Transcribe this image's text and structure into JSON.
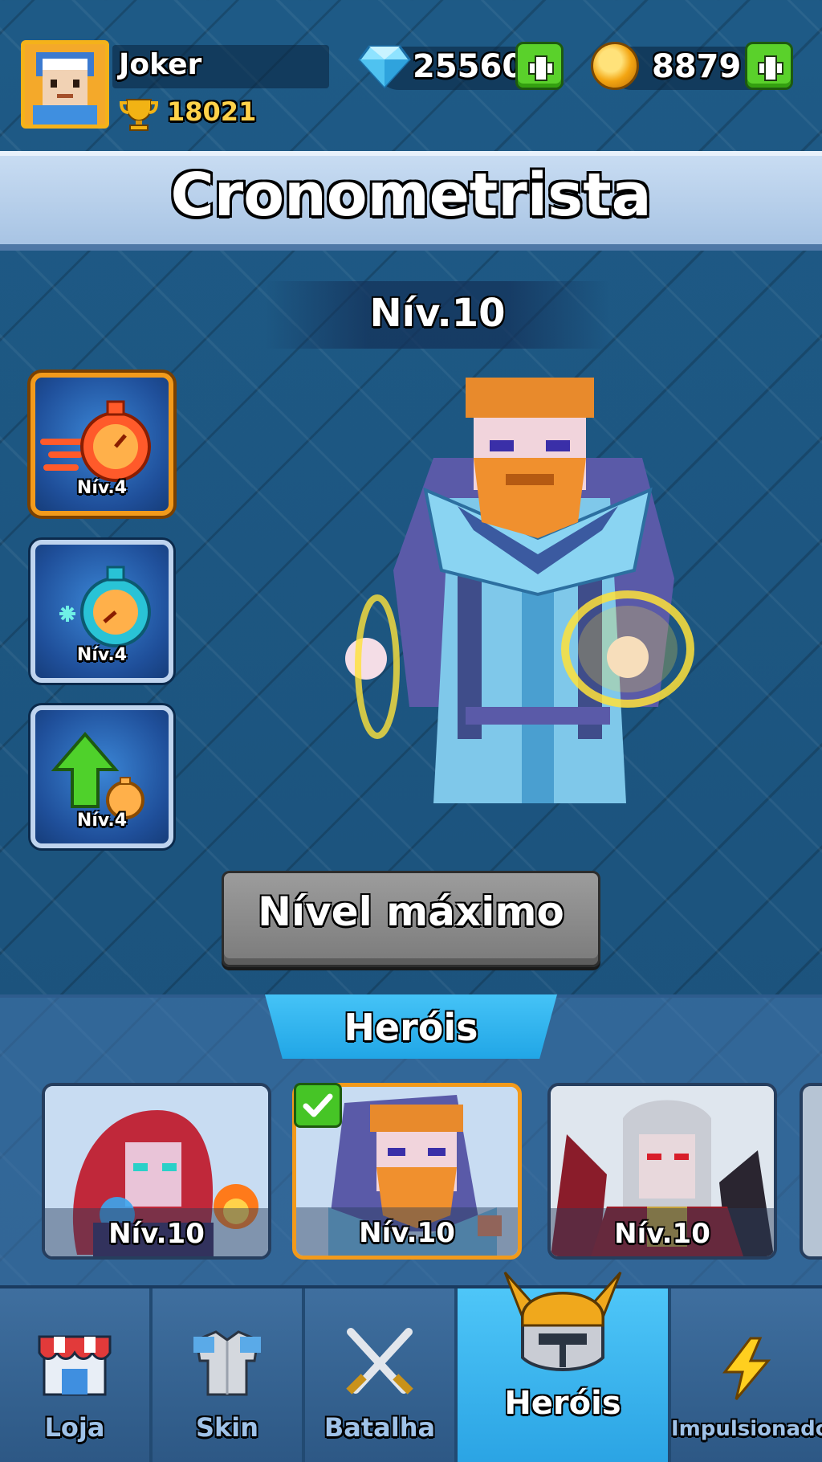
{
  "player": {
    "name": "Joker",
    "trophies": "18021"
  },
  "currency": {
    "gems": "25560",
    "coins": "8879"
  },
  "hero": {
    "name": "Cronometrista",
    "level": "Nív.10"
  },
  "skills": [
    {
      "level": "Nív.4",
      "icon": "stopwatch-fire-icon"
    },
    {
      "level": "Nív.4",
      "icon": "stopwatch-frost-icon"
    },
    {
      "level": "Nív.4",
      "icon": "upgrade-arrow-icon"
    }
  ],
  "max_level_button": "Nível máximo",
  "heroes_panel": {
    "tab_label": "Heróis",
    "cards": [
      {
        "level": "Nív.10"
      },
      {
        "level": "Nív.10"
      },
      {
        "level": "Nív.10"
      }
    ]
  },
  "nav": [
    {
      "label": "Loja"
    },
    {
      "label": "Skin"
    },
    {
      "label": "Batalha"
    },
    {
      "label": "Heróis"
    },
    {
      "label": "Impulsionador"
    }
  ],
  "colors": {
    "accent": "#f29a1b",
    "active_tab": "#2ba4e4",
    "green": "#5ad12b"
  }
}
